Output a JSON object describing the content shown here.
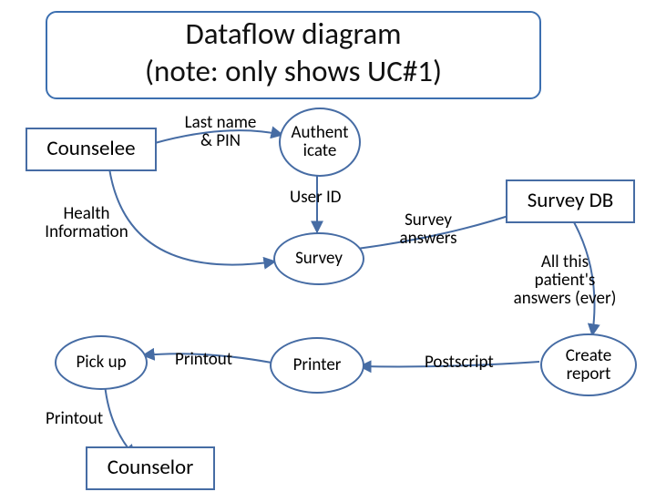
{
  "title": {
    "line1": "Dataflow diagram",
    "line2": "(note: only shows UC#1)"
  },
  "entities": {
    "counselee": "Counselee",
    "survey_db": "Survey DB",
    "counselor": "Counselor"
  },
  "processes": {
    "authenticate": "Authent\nicate",
    "survey": "Survey",
    "create_report": "Create\nreport",
    "printer": "Printer",
    "pick_up": "Pick up"
  },
  "flows": {
    "last_name_pin": "Last name\n& PIN",
    "user_id": "User ID",
    "health_information": "Health\nInformation",
    "survey_answers": "Survey\nanswers",
    "all_answers": "All this\npatient's\nanswers (ever)",
    "postscript": "Postscript",
    "printout_upper": "Printout",
    "printout_lower": "Printout"
  },
  "chart_data": {
    "type": "dataflow-diagram",
    "title": "Dataflow diagram (note: only shows UC#1)",
    "external_entities": [
      "Counselee",
      "Survey DB",
      "Counselor"
    ],
    "processes": [
      "Authenticate",
      "Survey",
      "Create report",
      "Printer",
      "Pick up"
    ],
    "flows": [
      {
        "from": "Counselee",
        "to": "Authenticate",
        "label": "Last name & PIN"
      },
      {
        "from": "Authenticate",
        "to": "Survey",
        "label": "User ID"
      },
      {
        "from": "Counselee",
        "to": "Survey",
        "label": "Health Information"
      },
      {
        "from": "Survey",
        "to": "Survey DB",
        "label": "Survey answers"
      },
      {
        "from": "Survey DB",
        "to": "Create report",
        "label": "All this patient's answers (ever)"
      },
      {
        "from": "Create report",
        "to": "Printer",
        "label": "Postscript"
      },
      {
        "from": "Printer",
        "to": "Pick up",
        "label": "Printout"
      },
      {
        "from": "Pick up",
        "to": "Counselor",
        "label": "Printout"
      }
    ]
  }
}
